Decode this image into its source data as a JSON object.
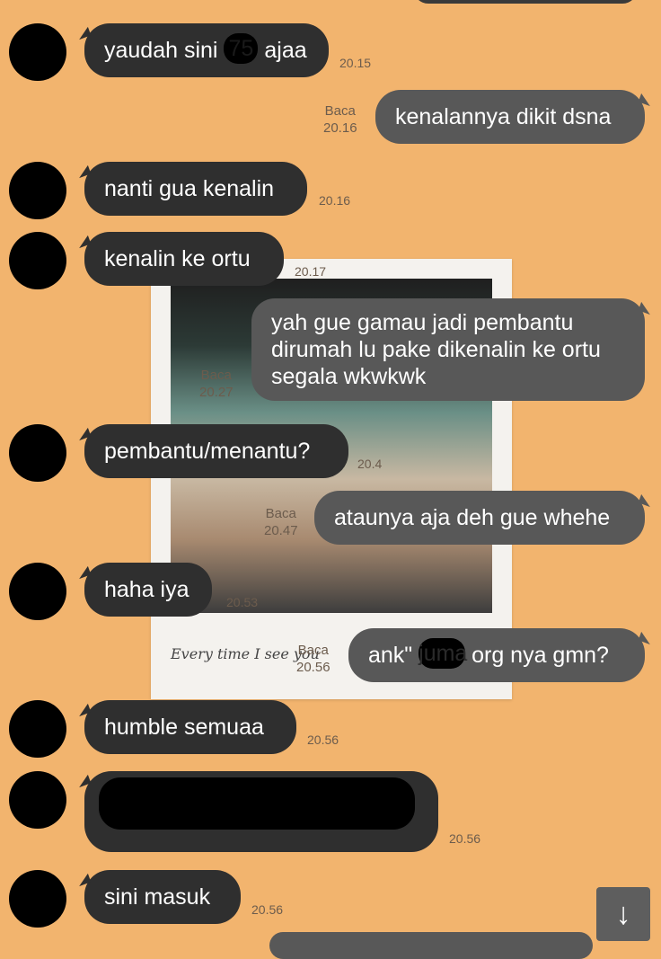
{
  "colors": {
    "background": "#f2b46e",
    "incoming": "#2f2f2f",
    "outgoing": "#585858"
  },
  "photo": {
    "caption": "Every time I see you"
  },
  "messages": [
    {
      "dir": "in",
      "text_before": "yaudah sini ",
      "redacted": "75",
      "text_after": " ajaa",
      "time": "20.15"
    },
    {
      "dir": "out",
      "text": "kenalannya dikit dsna",
      "read": "Baca",
      "time": "20.16"
    },
    {
      "dir": "in",
      "text": "nanti gua kenalin",
      "time": "20.16"
    },
    {
      "dir": "in",
      "text": "kenalin ke ortu",
      "time": "20.17"
    },
    {
      "dir": "out",
      "text": "yah gue gamau jadi pembantu dirumah lu pake dikenalin ke ortu segala wkwkwk",
      "read": "Baca",
      "time": "20.27"
    },
    {
      "dir": "in",
      "text": "pembantu/menantu?",
      "time": "20.4"
    },
    {
      "dir": "out",
      "text": "ataunya aja deh gue whehe",
      "read": "Baca",
      "time": "20.47"
    },
    {
      "dir": "in",
      "text": "haha iya",
      "time": "20.53"
    },
    {
      "dir": "out",
      "text_before": "ank\" ",
      "redacted": "juma",
      "text_after": " org nya gmn?",
      "read": "Baca",
      "time": "20.56"
    },
    {
      "dir": "in",
      "text": "humble semuaa",
      "time": "20.56"
    },
    {
      "dir": "in",
      "text": "",
      "time": "20.56"
    },
    {
      "dir": "in",
      "text": "sini masuk",
      "time": "20.56"
    }
  ],
  "scroll_button": {
    "icon": "arrow-down-icon",
    "glyph": "↓"
  }
}
